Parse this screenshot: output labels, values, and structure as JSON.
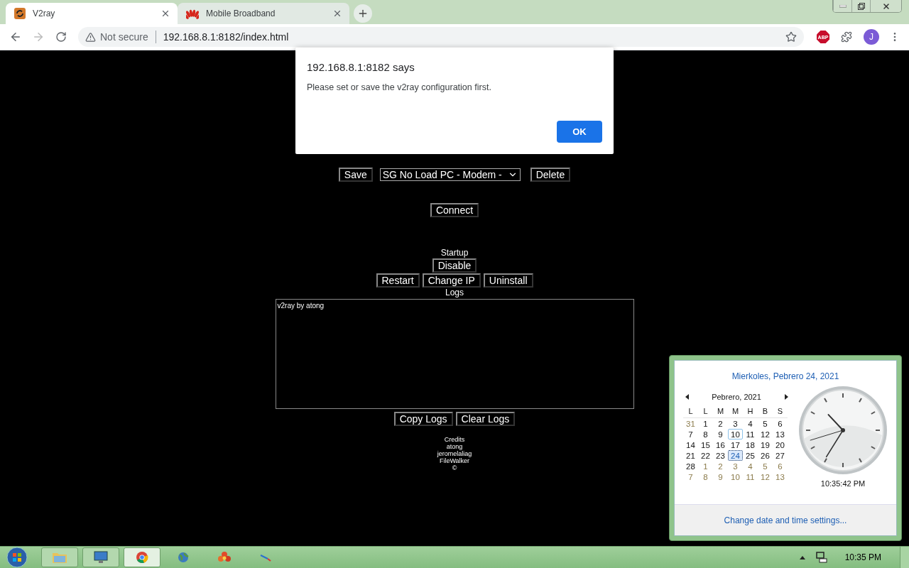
{
  "browser": {
    "tabs": [
      {
        "title": "V2ray",
        "kind": "v2ray",
        "selected": true
      },
      {
        "title": "Mobile Broadband",
        "kind": "router",
        "selected": false
      }
    ],
    "security": "Not secure",
    "url": "192.168.8.1:8182/index.html",
    "extension_badge": "ABP",
    "profile_initial": "J"
  },
  "page": {
    "save_button": "Save",
    "config_select": "SG No Load PC - Modem -",
    "delete_button": "Delete",
    "connect_button": "Connect",
    "startup_label": "Startup",
    "startup_button": "Disable",
    "actions": [
      "Restart",
      "Change IP",
      "Uninstall"
    ],
    "logs_label": "Logs",
    "logs_text": "v2ray by atong",
    "log_actions": [
      "Copy Logs",
      "Clear Logs"
    ],
    "credits": [
      "Credits",
      "atong",
      "jeromelaliag",
      "FileWalker",
      "©"
    ]
  },
  "dialog": {
    "title": "192.168.8.1:8182 says",
    "message": "Please set or save the v2ray configuration first.",
    "button": "OK"
  },
  "calendar": {
    "date_heading": "Mierkoles, Pebrero 24, 2021",
    "month": "Pebrero, 2021",
    "weekdays": [
      "L",
      "L",
      "M",
      "M",
      "H",
      "B",
      "S"
    ],
    "weeks": [
      [
        {
          "label": "31",
          "other": true,
          "selected": false,
          "hovered": false
        },
        {
          "label": "1",
          "other": false,
          "selected": false,
          "hovered": false
        },
        {
          "label": "2",
          "other": false,
          "selected": false,
          "hovered": false
        },
        {
          "label": "3",
          "other": false,
          "selected": false,
          "hovered": false
        },
        {
          "label": "4",
          "other": false,
          "selected": false,
          "hovered": false
        },
        {
          "label": "5",
          "other": false,
          "selected": false,
          "hovered": false
        },
        {
          "label": "6",
          "other": false,
          "selected": false,
          "hovered": false
        }
      ],
      [
        {
          "label": "7",
          "other": false,
          "selected": false,
          "hovered": false
        },
        {
          "label": "8",
          "other": false,
          "selected": false,
          "hovered": false
        },
        {
          "label": "9",
          "other": false,
          "selected": false,
          "hovered": false
        },
        {
          "label": "10",
          "other": false,
          "selected": false,
          "hovered": true
        },
        {
          "label": "11",
          "other": false,
          "selected": false,
          "hovered": false
        },
        {
          "label": "12",
          "other": false,
          "selected": false,
          "hovered": false
        },
        {
          "label": "13",
          "other": false,
          "selected": false,
          "hovered": false
        }
      ],
      [
        {
          "label": "14",
          "other": false,
          "selected": false,
          "hovered": false
        },
        {
          "label": "15",
          "other": false,
          "selected": false,
          "hovered": false
        },
        {
          "label": "16",
          "other": false,
          "selected": false,
          "hovered": false
        },
        {
          "label": "17",
          "other": false,
          "selected": false,
          "hovered": false
        },
        {
          "label": "18",
          "other": false,
          "selected": false,
          "hovered": false
        },
        {
          "label": "19",
          "other": false,
          "selected": false,
          "hovered": false
        },
        {
          "label": "20",
          "other": false,
          "selected": false,
          "hovered": false
        }
      ],
      [
        {
          "label": "21",
          "other": false,
          "selected": false,
          "hovered": false
        },
        {
          "label": "22",
          "other": false,
          "selected": false,
          "hovered": false
        },
        {
          "label": "23",
          "other": false,
          "selected": false,
          "hovered": false
        },
        {
          "label": "24",
          "other": false,
          "selected": true,
          "hovered": false
        },
        {
          "label": "25",
          "other": false,
          "selected": false,
          "hovered": false
        },
        {
          "label": "26",
          "other": false,
          "selected": false,
          "hovered": false
        },
        {
          "label": "27",
          "other": false,
          "selected": false,
          "hovered": false
        }
      ],
      [
        {
          "label": "28",
          "other": false,
          "selected": false,
          "hovered": false
        },
        {
          "label": "1",
          "other": true,
          "selected": false,
          "hovered": false
        },
        {
          "label": "2",
          "other": true,
          "selected": false,
          "hovered": false
        },
        {
          "label": "3",
          "other": true,
          "selected": false,
          "hovered": false
        },
        {
          "label": "4",
          "other": true,
          "selected": false,
          "hovered": false
        },
        {
          "label": "5",
          "other": true,
          "selected": false,
          "hovered": false
        },
        {
          "label": "6",
          "other": true,
          "selected": false,
          "hovered": false
        }
      ],
      [
        {
          "label": "7",
          "other": true,
          "selected": false,
          "hovered": false
        },
        {
          "label": "8",
          "other": true,
          "selected": false,
          "hovered": false
        },
        {
          "label": "9",
          "other": true,
          "selected": false,
          "hovered": false
        },
        {
          "label": "10",
          "other": true,
          "selected": false,
          "hovered": false
        },
        {
          "label": "11",
          "other": true,
          "selected": false,
          "hovered": false
        },
        {
          "label": "12",
          "other": true,
          "selected": false,
          "hovered": false
        },
        {
          "label": "13",
          "other": true,
          "selected": false,
          "hovered": false
        }
      ]
    ],
    "time": "10:35:42 PM",
    "settings_link": "Change date and time settings..."
  },
  "taskbar": {
    "apps": [
      {
        "kind": "folder",
        "running": true,
        "selected": false
      },
      {
        "kind": "monitor",
        "running": true,
        "selected": false
      },
      {
        "kind": "browser",
        "running": true,
        "selected": true
      },
      {
        "kind": "globe",
        "running": false,
        "selected": false
      },
      {
        "kind": "flower",
        "running": false,
        "selected": false
      },
      {
        "kind": "pen",
        "running": false,
        "selected": false
      }
    ],
    "clock": "10:35 PM"
  }
}
